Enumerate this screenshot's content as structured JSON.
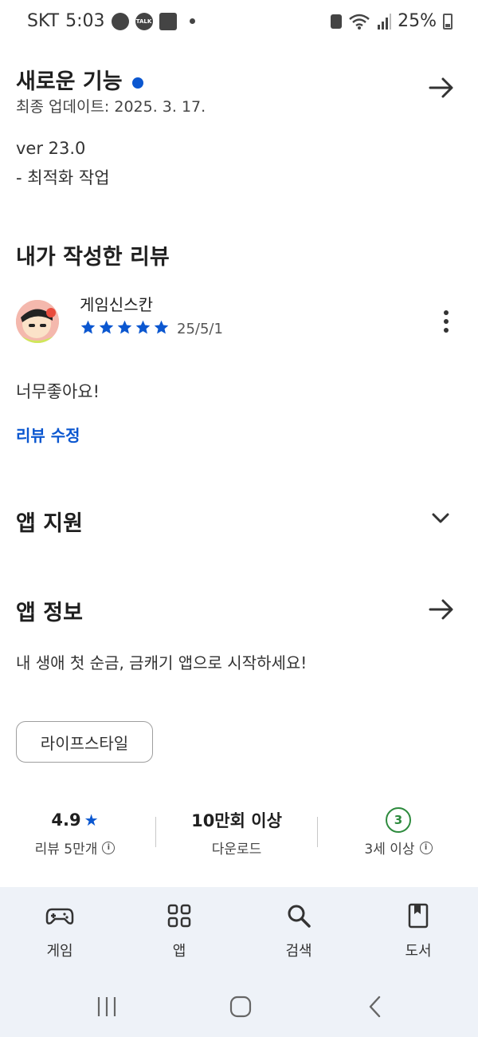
{
  "status_bar": {
    "carrier": "SKT",
    "time": "5:03",
    "notif_talk": "TALK",
    "battery": "25%"
  },
  "whats_new": {
    "title": "새로운 기능",
    "updated": "최종 업데이트: 2025. 3. 17.",
    "version": "ver 23.0",
    "notes": "- 최적화 작업"
  },
  "my_review": {
    "section_title": "내가 작성한 리뷰",
    "user_name": "게임신스칸",
    "stars": 5,
    "date": "25/5/1",
    "text": "너무좋아요!",
    "edit_label": "리뷰 수정"
  },
  "app_support": {
    "title": "앱 지원"
  },
  "app_info": {
    "title": "앱 정보",
    "description": "내 생애 첫 순금, 금캐기 앱으로 시작하세요!",
    "category_chip": "라이프스타일"
  },
  "stats": {
    "rating": "4.9",
    "rating_label": "리뷰 5만개",
    "downloads": "10만회 이상",
    "downloads_label": "다운로드",
    "age_badge": "3",
    "age_label": "3세 이상"
  },
  "bottom_nav": {
    "items": [
      {
        "label": "게임",
        "icon": "gamepad-icon"
      },
      {
        "label": "앱",
        "icon": "apps-grid-icon"
      },
      {
        "label": "검색",
        "icon": "search-icon"
      },
      {
        "label": "도서",
        "icon": "book-icon"
      }
    ]
  },
  "colors": {
    "accent": "#0b57d0",
    "age_badge": "#2e8b3e",
    "nav_bg": "#eef2f8"
  }
}
